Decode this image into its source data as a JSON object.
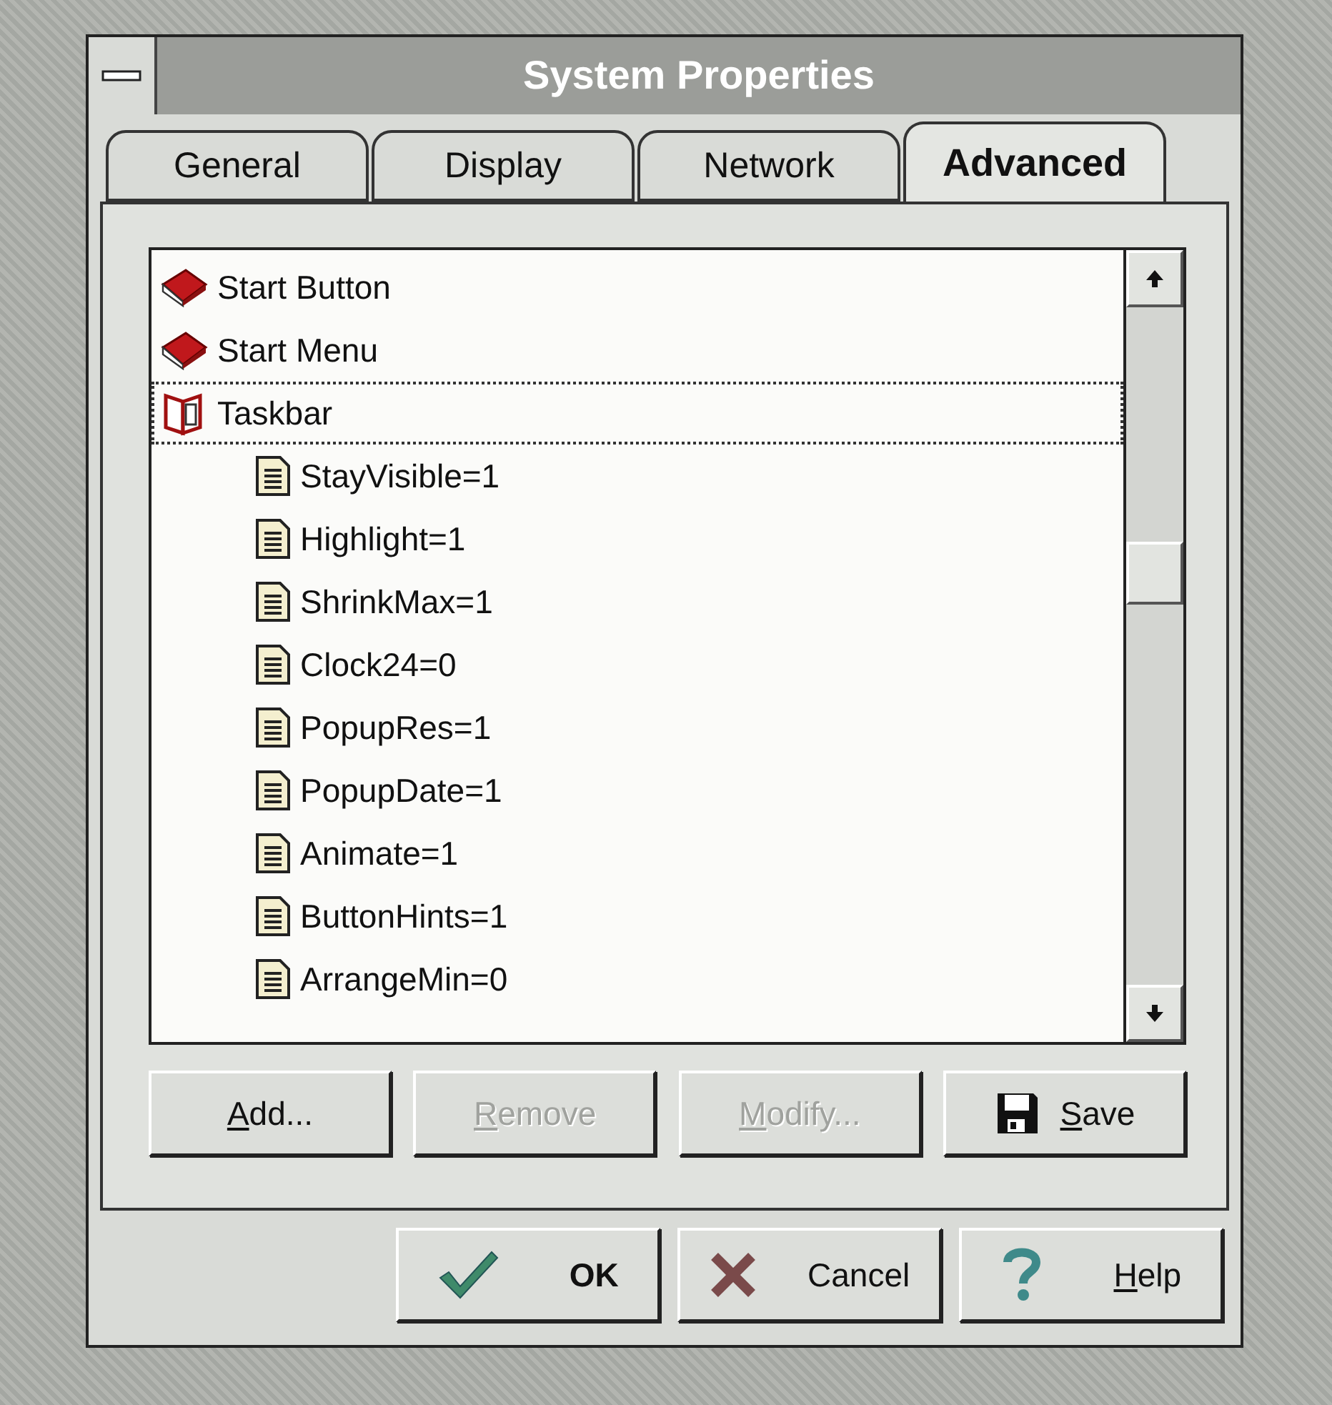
{
  "window": {
    "title": "System Properties"
  },
  "tabs": [
    {
      "label": "General",
      "selected": false
    },
    {
      "label": "Display",
      "selected": false
    },
    {
      "label": "Network",
      "selected": false
    },
    {
      "label": "Advanced",
      "selected": true
    }
  ],
  "tree": {
    "items": [
      {
        "label": "Start Button",
        "kind": "folder",
        "expanded": false,
        "selected": false
      },
      {
        "label": "Start Menu",
        "kind": "folder",
        "expanded": false,
        "selected": false
      },
      {
        "label": "Taskbar",
        "kind": "folder",
        "expanded": true,
        "selected": true,
        "children": [
          {
            "label": "StayVisible=1",
            "kind": "value",
            "selected": false
          },
          {
            "label": "Highlight=1",
            "kind": "value",
            "selected": false
          },
          {
            "label": "ShrinkMax=1",
            "kind": "value",
            "selected": false
          },
          {
            "label": "Clock24=0",
            "kind": "value",
            "selected": false
          },
          {
            "label": "PopupRes=1",
            "kind": "value",
            "selected": false
          },
          {
            "label": "PopupDate=1",
            "kind": "value",
            "selected": false
          },
          {
            "label": "Animate=1",
            "kind": "value",
            "selected": false
          },
          {
            "label": "ButtonHints=1",
            "kind": "value",
            "selected": false
          },
          {
            "label": "ArrangeMin=0",
            "kind": "value",
            "selected": false
          }
        ]
      }
    ]
  },
  "panel_buttons": [
    {
      "label": "Add...",
      "underline_first": true,
      "disabled": false
    },
    {
      "label": "Remove",
      "underline_first": true,
      "disabled": true
    },
    {
      "label": "Modify...",
      "underline_first": true,
      "disabled": true
    },
    {
      "label": "Save",
      "underline_first": true,
      "disabled": false
    }
  ],
  "dialog_buttons": [
    {
      "label": "OK",
      "underline_first": false,
      "disabled": false,
      "default": true
    },
    {
      "label": "Cancel",
      "underline_first": false,
      "disabled": false,
      "default": false
    },
    {
      "label": "Help",
      "underline_first": true,
      "disabled": false,
      "default": false
    }
  ]
}
